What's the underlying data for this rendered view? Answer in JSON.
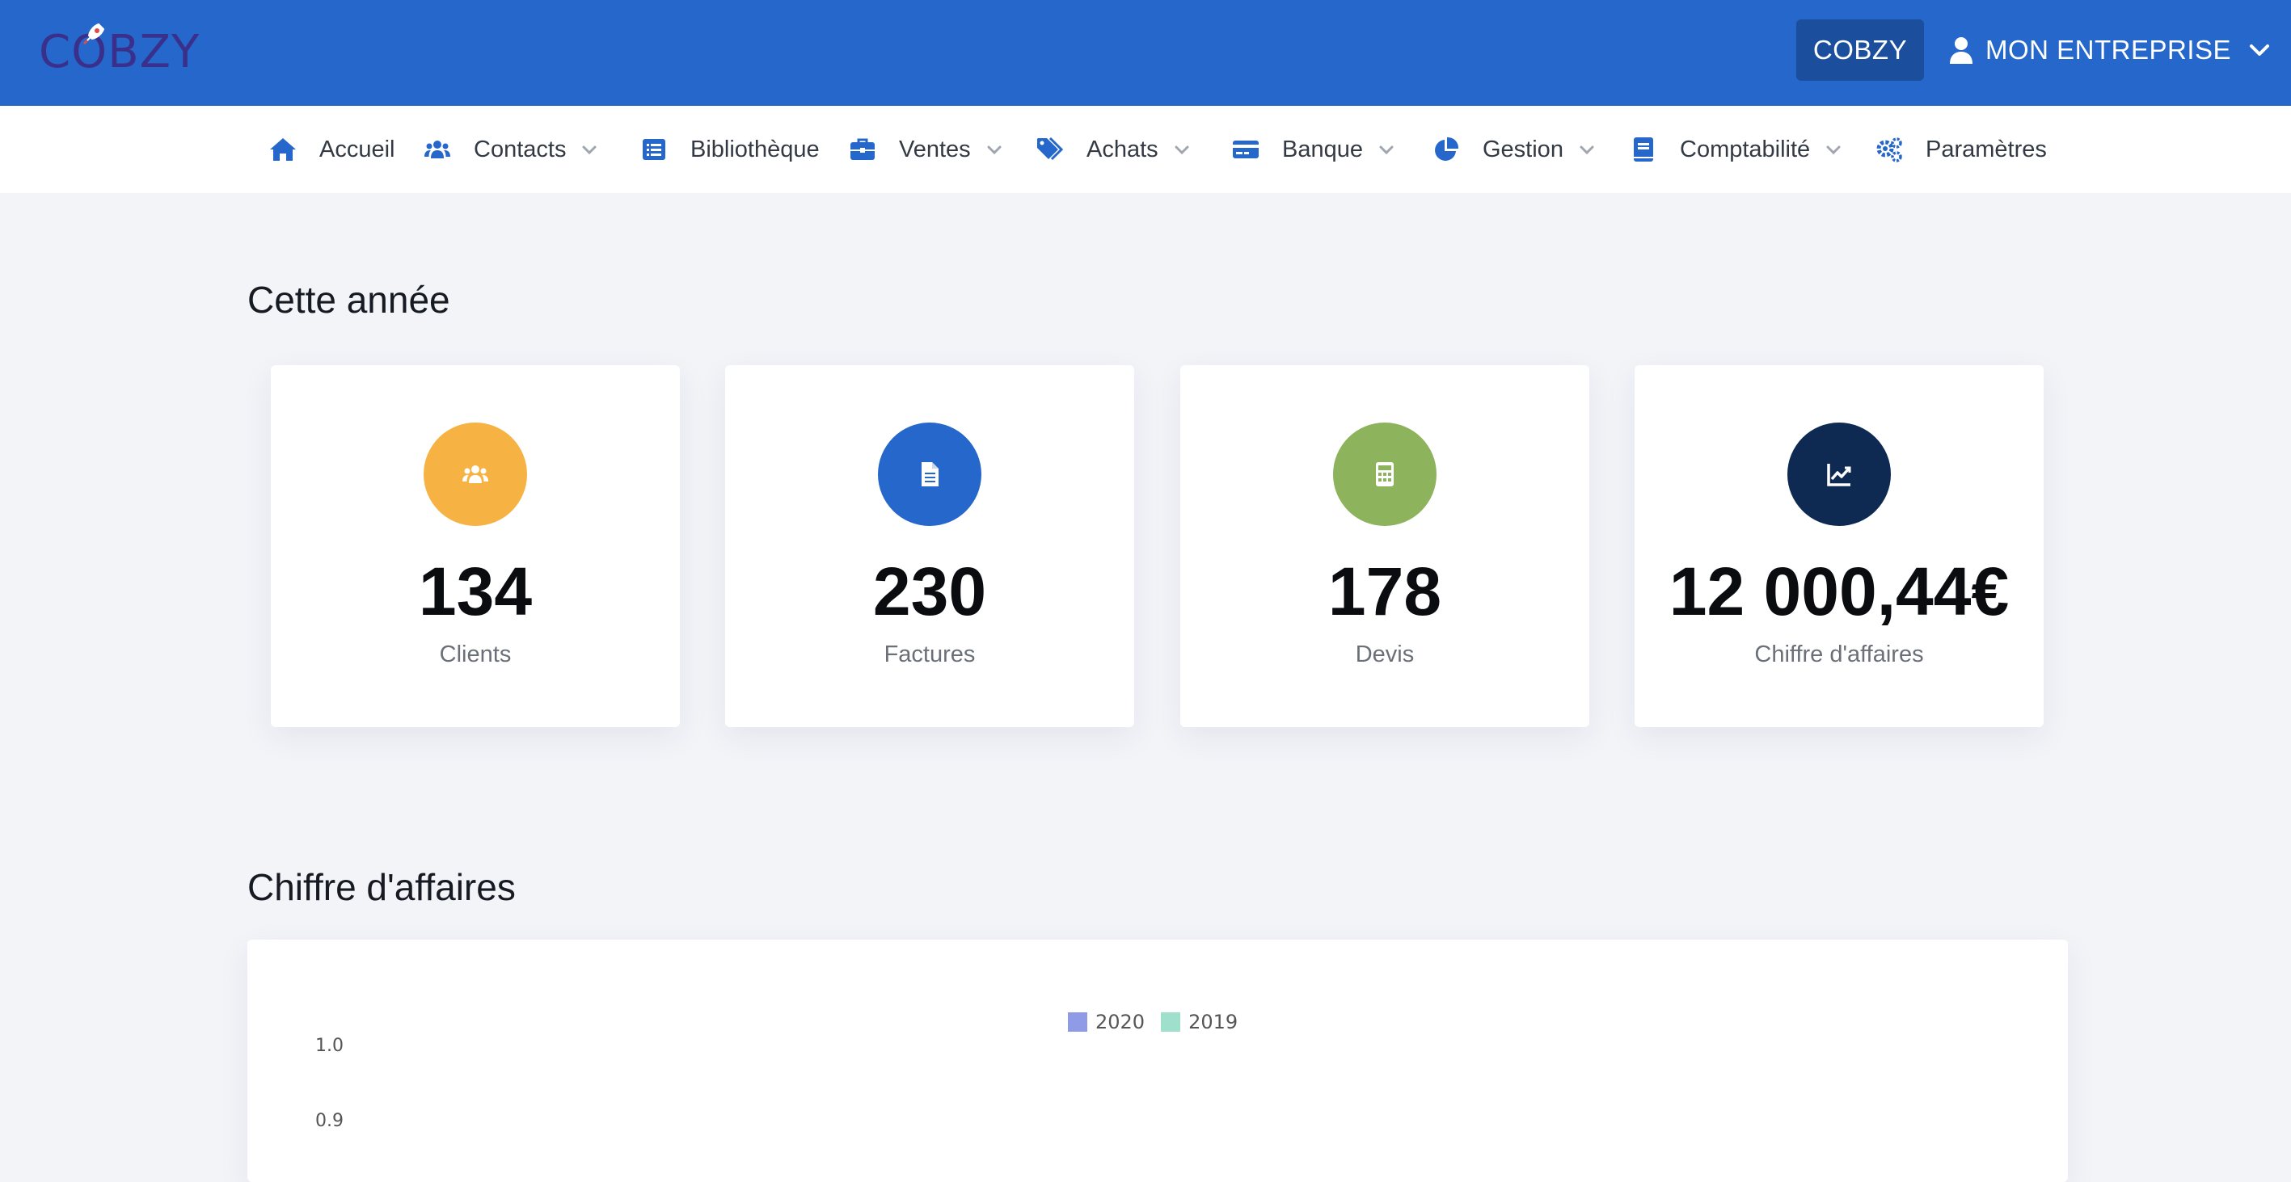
{
  "header": {
    "logo_text": "COBZY",
    "company_button": "COBZY",
    "account_label": "MON ENTREPRISE",
    "bg_color": "#2567ca"
  },
  "nav": {
    "items": [
      {
        "label": "Accueil",
        "icon": "home-icon",
        "dropdown": false
      },
      {
        "label": "Contacts",
        "icon": "users-icon",
        "dropdown": true
      },
      {
        "label": "Bibliothèque",
        "icon": "list-icon",
        "dropdown": false
      },
      {
        "label": "Ventes",
        "icon": "briefcase-icon",
        "dropdown": true
      },
      {
        "label": "Achats",
        "icon": "tags-icon",
        "dropdown": true
      },
      {
        "label": "Banque",
        "icon": "credit-card-icon",
        "dropdown": true
      },
      {
        "label": "Gestion",
        "icon": "pie-chart-icon",
        "dropdown": true
      },
      {
        "label": "Comptabilité",
        "icon": "book-icon",
        "dropdown": true
      },
      {
        "label": "Paramètres",
        "icon": "cogs-icon",
        "dropdown": false
      }
    ]
  },
  "year_section": {
    "title": "Cette année",
    "cards": [
      {
        "value": "134",
        "label": "Clients",
        "icon": "users-icon",
        "color": "#f6b344"
      },
      {
        "value": "230",
        "label": "Factures",
        "icon": "file-icon",
        "color": "#2567ca"
      },
      {
        "value": "178",
        "label": "Devis",
        "icon": "calculator-icon",
        "color": "#8db35d"
      },
      {
        "value": "12 000,44€",
        "label": "Chiffre d'affaires",
        "icon": "chart-line-icon",
        "color": "#0e2a52"
      }
    ]
  },
  "revenue_section": {
    "title": "Chiffre d'affaires"
  },
  "chart_data": {
    "type": "bar",
    "series": [
      {
        "name": "2020",
        "values": [],
        "color": "#8f9be6"
      },
      {
        "name": "2019",
        "values": [],
        "color": "#9ee0cb"
      }
    ],
    "y_ticks": [
      "1.0",
      "0.9"
    ],
    "legend": "top-center"
  }
}
